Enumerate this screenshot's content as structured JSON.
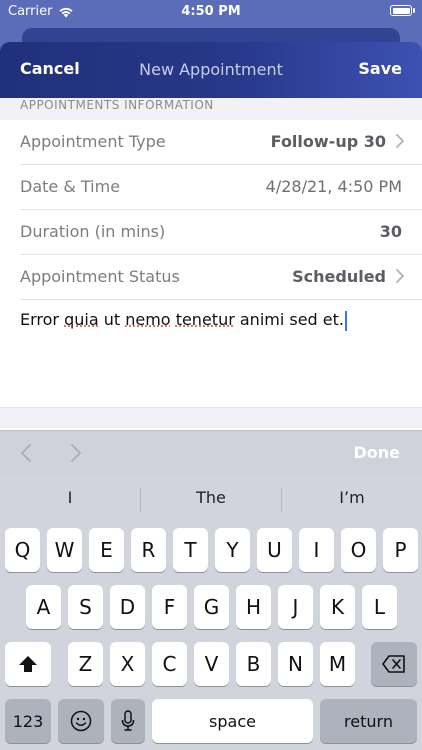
{
  "status_bar": {
    "carrier": "Carrier",
    "time": "4:50 PM"
  },
  "header": {
    "cancel": "Cancel",
    "title": "New Appointment",
    "save": "Save"
  },
  "section_title": "APPOINTMENTS INFORMATION",
  "rows": [
    {
      "label": "Appointment Type",
      "value": "Follow-up 30"
    },
    {
      "label": "Date & Time",
      "value": "4/28/21, 4:50 PM"
    },
    {
      "label": "Duration (in mins)",
      "value": "30"
    },
    {
      "label": "Appointment Status",
      "value": "Scheduled"
    }
  ],
  "notes": {
    "part1": "Error ",
    "part2": "quia",
    "part3": " ut ",
    "part4": "nemo",
    "part5": " ",
    "part6": "tenetur",
    "part7": " animi sed et."
  },
  "accessory": {
    "done": "Done"
  },
  "keyboard": {
    "suggestions": [
      "I",
      "The",
      "I’m"
    ],
    "row1": [
      "Q",
      "W",
      "E",
      "R",
      "T",
      "Y",
      "U",
      "I",
      "O",
      "P"
    ],
    "row2": [
      "A",
      "S",
      "D",
      "F",
      "G",
      "H",
      "J",
      "K",
      "L"
    ],
    "row3": [
      "Z",
      "X",
      "C",
      "V",
      "B",
      "N",
      "M"
    ],
    "numbers_key": "123",
    "space_key": "space",
    "return_key": "return"
  },
  "colors": {
    "header_start": "#21307a",
    "header_end": "#3c51b2",
    "cursor": "#3478f6"
  }
}
